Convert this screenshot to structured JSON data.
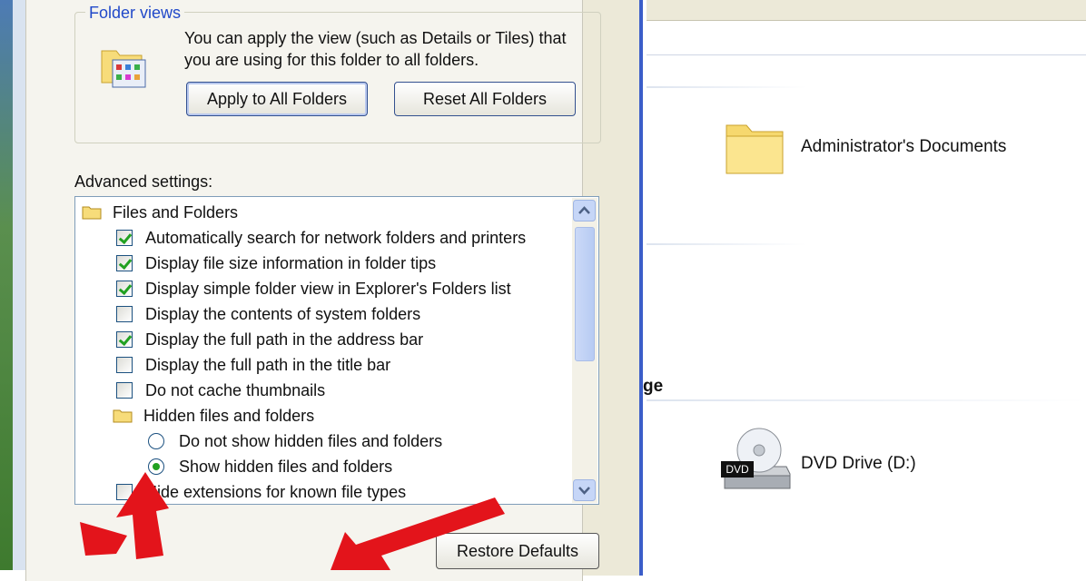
{
  "dialog": {
    "folder_views": {
      "title": "Folder views",
      "description": "You can apply the view (such as Details or Tiles) that you are using for this folder to all folders.",
      "apply_button": "Apply to All Folders",
      "reset_button": "Reset All Folders"
    },
    "advanced_label": "Advanced settings:",
    "settings": {
      "group1": "Files and Folders",
      "items": [
        {
          "label": "Automatically search for network folders and printers",
          "checked": true
        },
        {
          "label": "Display file size information in folder tips",
          "checked": true
        },
        {
          "label": "Display simple folder view in Explorer's Folders list",
          "checked": true
        },
        {
          "label": "Display the contents of system folders",
          "checked": false
        },
        {
          "label": "Display the full path in the address bar",
          "checked": true
        },
        {
          "label": "Display the full path in the title bar",
          "checked": false
        },
        {
          "label": "Do not cache thumbnails",
          "checked": false
        }
      ],
      "group2": "Hidden files and folders",
      "radios": [
        {
          "label": "Do not show hidden files and folders",
          "selected": false
        },
        {
          "label": "Show hidden files and folders",
          "selected": true
        }
      ],
      "last_item": {
        "label": "Hide extensions for known file types",
        "checked": false
      }
    },
    "restore_button": "Restore Defaults"
  },
  "explorer": {
    "documents_label": "Administrator's Documents",
    "group_label_fragment": "ge",
    "dvd_label": "DVD Drive (D:)",
    "dvd_badge": "DVD"
  },
  "colors": {
    "accent_blue": "#2149c9",
    "check_green": "#21a121",
    "arrow_red": "#e3141b"
  }
}
